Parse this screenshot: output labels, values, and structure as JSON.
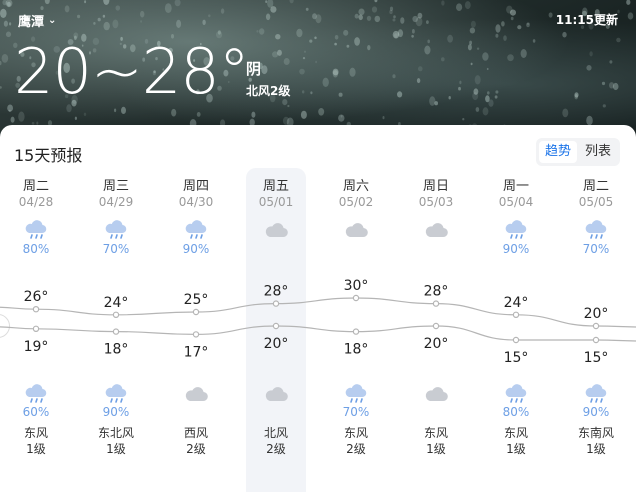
{
  "header": {
    "city": "鹰潭",
    "updated": "11:15更新",
    "temp_range": "20~28°",
    "condition": "阴",
    "wind": "北风2级"
  },
  "forecast": {
    "title": "15天预报",
    "toggle": {
      "trend": "趋势",
      "list": "列表",
      "active": "trend"
    },
    "days": [
      {
        "day": "周二",
        "date": "04/28",
        "icon_top": "rain-icon",
        "pop_top": "80%",
        "high": "26°",
        "low": "19°",
        "icon_bottom": "rain-icon",
        "pop_bottom": "60%",
        "wind_dir": "东风",
        "wind_lvl": "1级"
      },
      {
        "day": "周三",
        "date": "04/29",
        "icon_top": "rain-icon",
        "pop_top": "70%",
        "high": "24°",
        "low": "18°",
        "icon_bottom": "rain-icon",
        "pop_bottom": "90%",
        "wind_dir": "东北风",
        "wind_lvl": "1级"
      },
      {
        "day": "周四",
        "date": "04/30",
        "icon_top": "rain-icon",
        "pop_top": "90%",
        "high": "25°",
        "low": "17°",
        "icon_bottom": "cloud-icon",
        "pop_bottom": "",
        "wind_dir": "西风",
        "wind_lvl": "2级"
      },
      {
        "day": "周五",
        "date": "05/01",
        "icon_top": "cloud-icon",
        "pop_top": "",
        "high": "28°",
        "low": "20°",
        "icon_bottom": "cloud-icon",
        "pop_bottom": "",
        "wind_dir": "北风",
        "wind_lvl": "2级"
      },
      {
        "day": "周六",
        "date": "05/02",
        "icon_top": "cloud-icon",
        "pop_top": "",
        "high": "30°",
        "low": "18°",
        "icon_bottom": "rain-icon",
        "pop_bottom": "70%",
        "wind_dir": "东风",
        "wind_lvl": "2级"
      },
      {
        "day": "周日",
        "date": "05/03",
        "icon_top": "cloud-icon",
        "pop_top": "",
        "high": "28°",
        "low": "20°",
        "icon_bottom": "cloud-icon",
        "pop_bottom": "",
        "wind_dir": "东风",
        "wind_lvl": "1级"
      },
      {
        "day": "周一",
        "date": "05/04",
        "icon_top": "rain-icon",
        "pop_top": "90%",
        "high": "24°",
        "low": "15°",
        "icon_bottom": "rain-icon",
        "pop_bottom": "80%",
        "wind_dir": "东风",
        "wind_lvl": "1级"
      },
      {
        "day": "周二",
        "date": "05/05",
        "icon_top": "rain-icon",
        "pop_top": "70%",
        "high": "20°",
        "low": "15°",
        "icon_bottom": "rain-icon",
        "pop_bottom": "90%",
        "wind_dir": "东南风",
        "wind_lvl": "1级"
      }
    ]
  },
  "colors": {
    "accent": "#1a73e8",
    "precip": "#6d9fe5",
    "line": "#b5b5b5"
  }
}
